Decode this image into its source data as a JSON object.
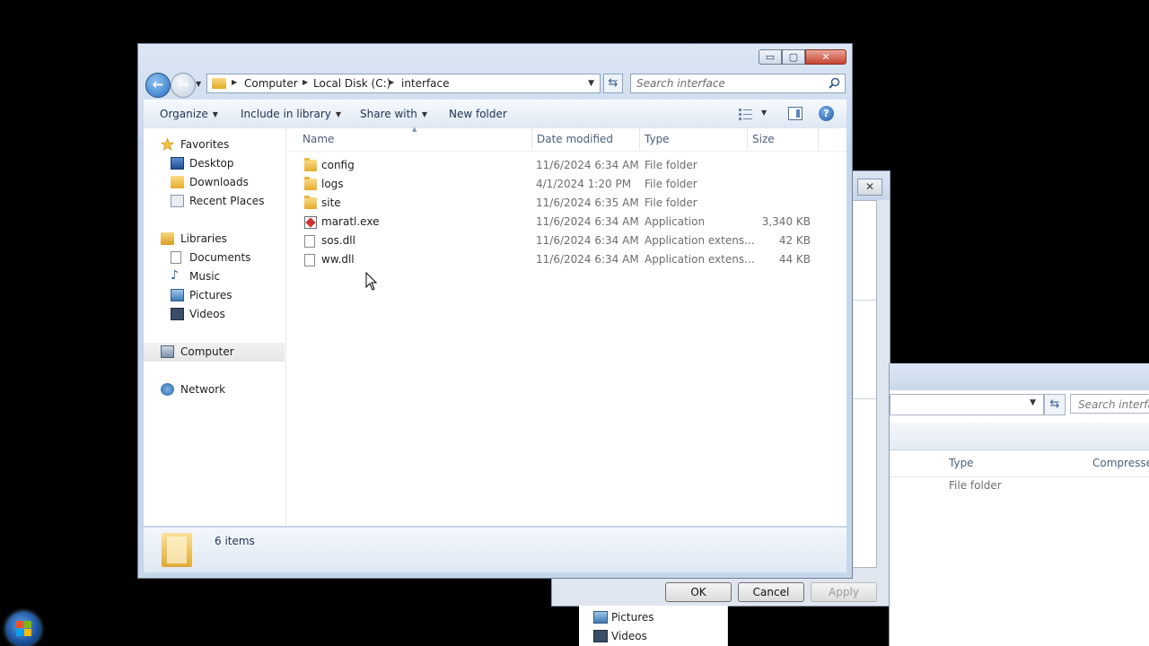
{
  "window": {
    "minimize_glyph": "▭",
    "maximize_glyph": "▢",
    "close_glyph": "✕"
  },
  "address": {
    "crumbs": [
      "Computer",
      "Local Disk (C:)",
      "interface"
    ]
  },
  "search": {
    "placeholder": "Search interface"
  },
  "command_bar": {
    "organize": "Organize",
    "include_in_library": "Include in library",
    "share_with": "Share with",
    "new_folder": "New folder"
  },
  "nav": {
    "favorites": "Favorites",
    "desktop": "Desktop",
    "downloads": "Downloads",
    "recent_places": "Recent Places",
    "libraries": "Libraries",
    "documents": "Documents",
    "music": "Music",
    "pictures": "Pictures",
    "videos": "Videos",
    "computer": "Computer",
    "network": "Network"
  },
  "columns": {
    "name": "Name",
    "date_modified": "Date modified",
    "type": "Type",
    "size": "Size"
  },
  "files": [
    {
      "name": "config",
      "date": "11/6/2024 6:34 AM",
      "type": "File folder",
      "size": "",
      "icon": "folder-icon"
    },
    {
      "name": "logs",
      "date": "4/1/2024 1:20 PM",
      "type": "File folder",
      "size": "",
      "icon": "folder-icon"
    },
    {
      "name": "site",
      "date": "11/6/2024 6:35 AM",
      "type": "File folder",
      "size": "",
      "icon": "folder-icon"
    },
    {
      "name": "maratl.exe",
      "date": "11/6/2024 6:34 AM",
      "type": "Application",
      "size": "3,340 KB",
      "icon": "application-icon"
    },
    {
      "name": "sos.dll",
      "date": "11/6/2024 6:34 AM",
      "type": "Application extens...",
      "size": "42 KB",
      "icon": "dll-file-icon"
    },
    {
      "name": "ww.dll",
      "date": "11/6/2024 6:34 AM",
      "type": "Application extens...",
      "size": "44 KB",
      "icon": "dll-file-icon"
    }
  ],
  "status": {
    "item_count": "6 items"
  },
  "background_dialog": {
    "close_glyph": "✕",
    "ok": "OK",
    "cancel": "Cancel",
    "apply": "Apply"
  },
  "background_explorer": {
    "search_placeholder": "Search interface",
    "col_type": "Type",
    "col_compressed": "Compressed",
    "row_type": "File folder",
    "nav_pictures": "Pictures",
    "nav_videos": "Videos"
  }
}
